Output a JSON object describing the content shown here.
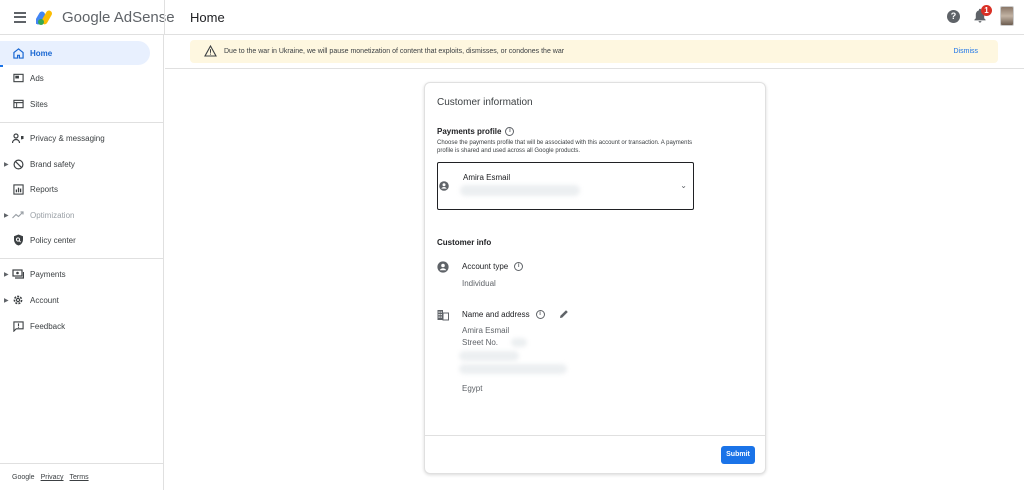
{
  "header": {
    "brand_google": "Google",
    "brand_product": "AdSense",
    "page_title": "Home",
    "help_icon": "help-icon",
    "notification_count": "1"
  },
  "sidebar": {
    "items": [
      {
        "label": "Home",
        "icon": "home-icon"
      },
      {
        "label": "Ads",
        "icon": "ads-icon"
      },
      {
        "label": "Sites",
        "icon": "sites-icon"
      },
      {
        "label": "Privacy & messaging",
        "icon": "privacy-icon"
      },
      {
        "label": "Brand safety",
        "icon": "block-icon"
      },
      {
        "label": "Reports",
        "icon": "reports-icon"
      },
      {
        "label": "Optimization",
        "icon": "trending-icon"
      },
      {
        "label": "Policy center",
        "icon": "policy-icon"
      },
      {
        "label": "Payments",
        "icon": "payments-icon"
      },
      {
        "label": "Account",
        "icon": "gear-icon"
      },
      {
        "label": "Feedback",
        "icon": "feedback-icon"
      }
    ],
    "footer": {
      "google": "Google",
      "privacy": "Privacy",
      "terms": "Terms"
    }
  },
  "banner": {
    "message": "Due to the war in Ukraine, we will pause monetization of content that exploits, dismisses, or condones the war",
    "dismiss_label": "Dismiss"
  },
  "card": {
    "title": "Customer information",
    "payments_profile": {
      "title": "Payments profile",
      "description": "Choose the payments profile that will be associated with this account or transaction. A payments profile is shared and used across all Google products.",
      "selected_name": "Amira Esmail"
    },
    "customer_info": {
      "title": "Customer info",
      "account_type_label": "Account type",
      "account_type_value": "Individual",
      "name_address_label": "Name and address",
      "address_name": "Amira Esmail",
      "address_street": "Street No.",
      "address_country": "Egypt"
    },
    "submit_label": "Submit"
  },
  "colors": {
    "accent": "#1a73e8",
    "active_bg": "#e8f0fe",
    "banner_bg": "#fef7e0",
    "badge": "#d93025"
  }
}
